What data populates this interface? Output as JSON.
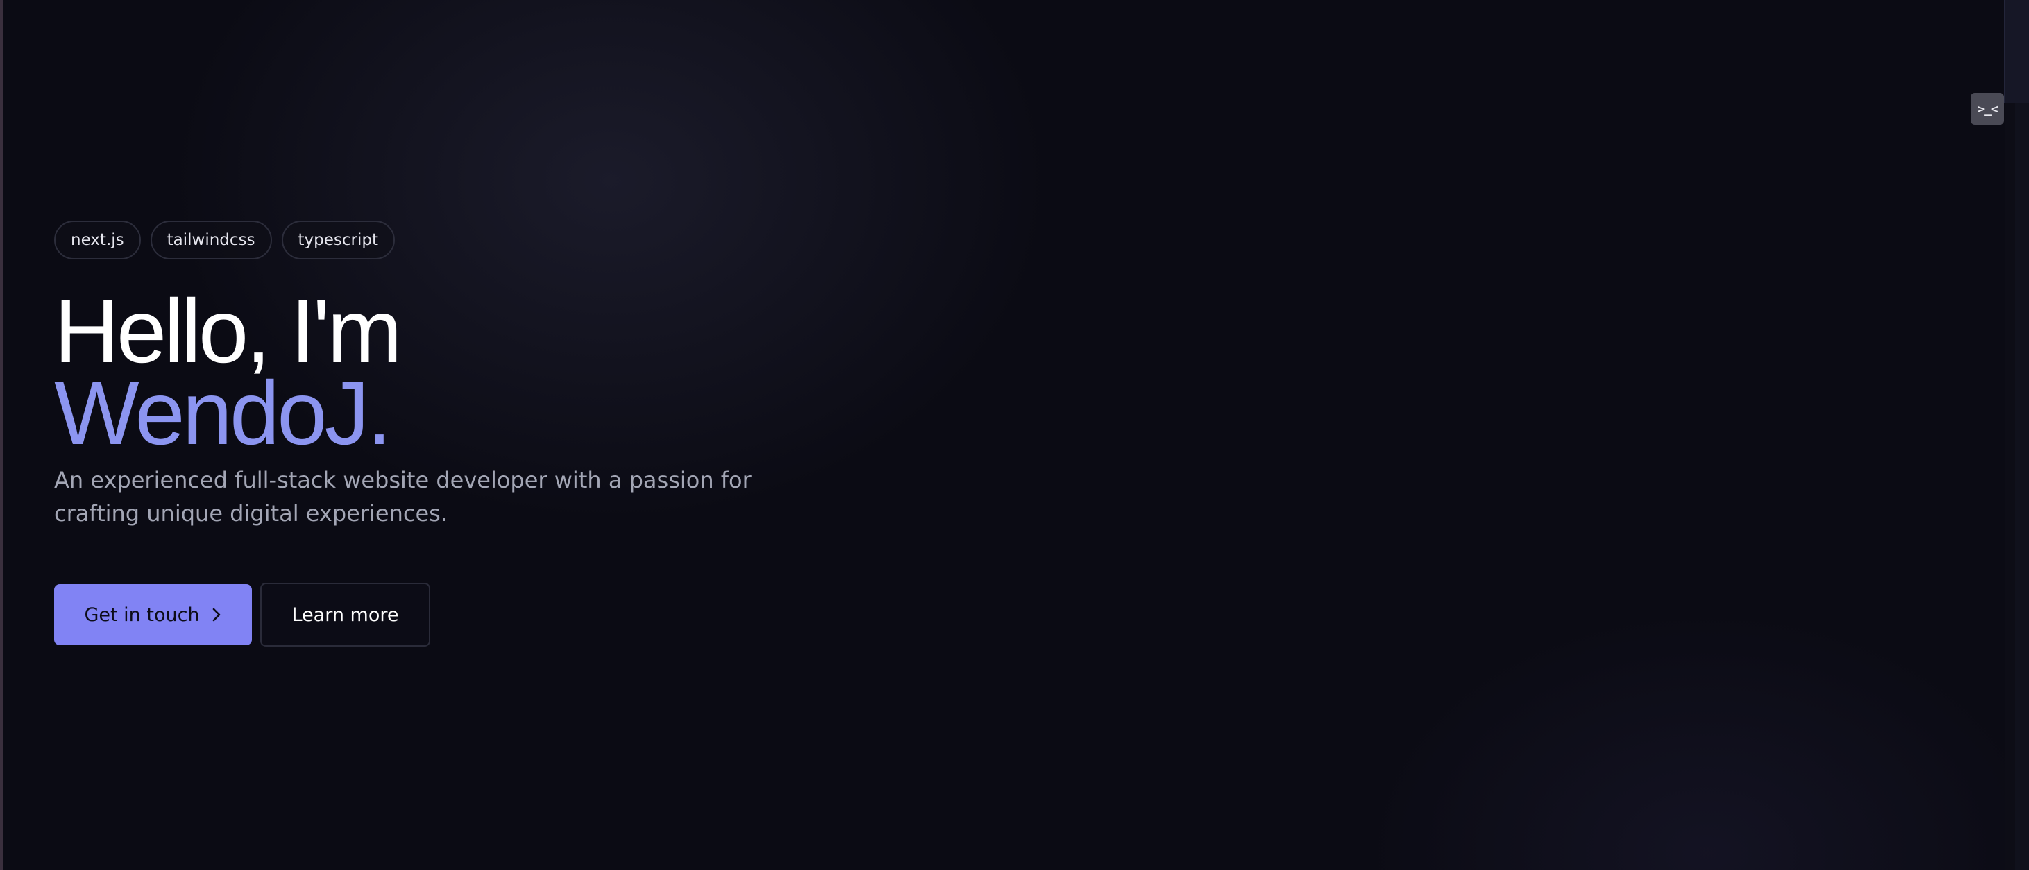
{
  "hero": {
    "tags": [
      "next.js",
      "tailwindcss",
      "typescript"
    ],
    "headline_line1": "Hello, I'm",
    "headline_line2": "WendoJ.",
    "subtitle": "An experienced full-stack website developer with a passion for crafting unique digital experiences.",
    "primary_button": "Get in touch",
    "secondary_button": "Learn more"
  },
  "devtools": {
    "toggle_label": ">_<",
    "toggle_icon": "terminal-face-icon"
  },
  "colors": {
    "background": "#0b0b14",
    "accent": "#8183f4",
    "name_highlight": "#8c95f0",
    "subtitle_text": "#a3a6b5"
  }
}
